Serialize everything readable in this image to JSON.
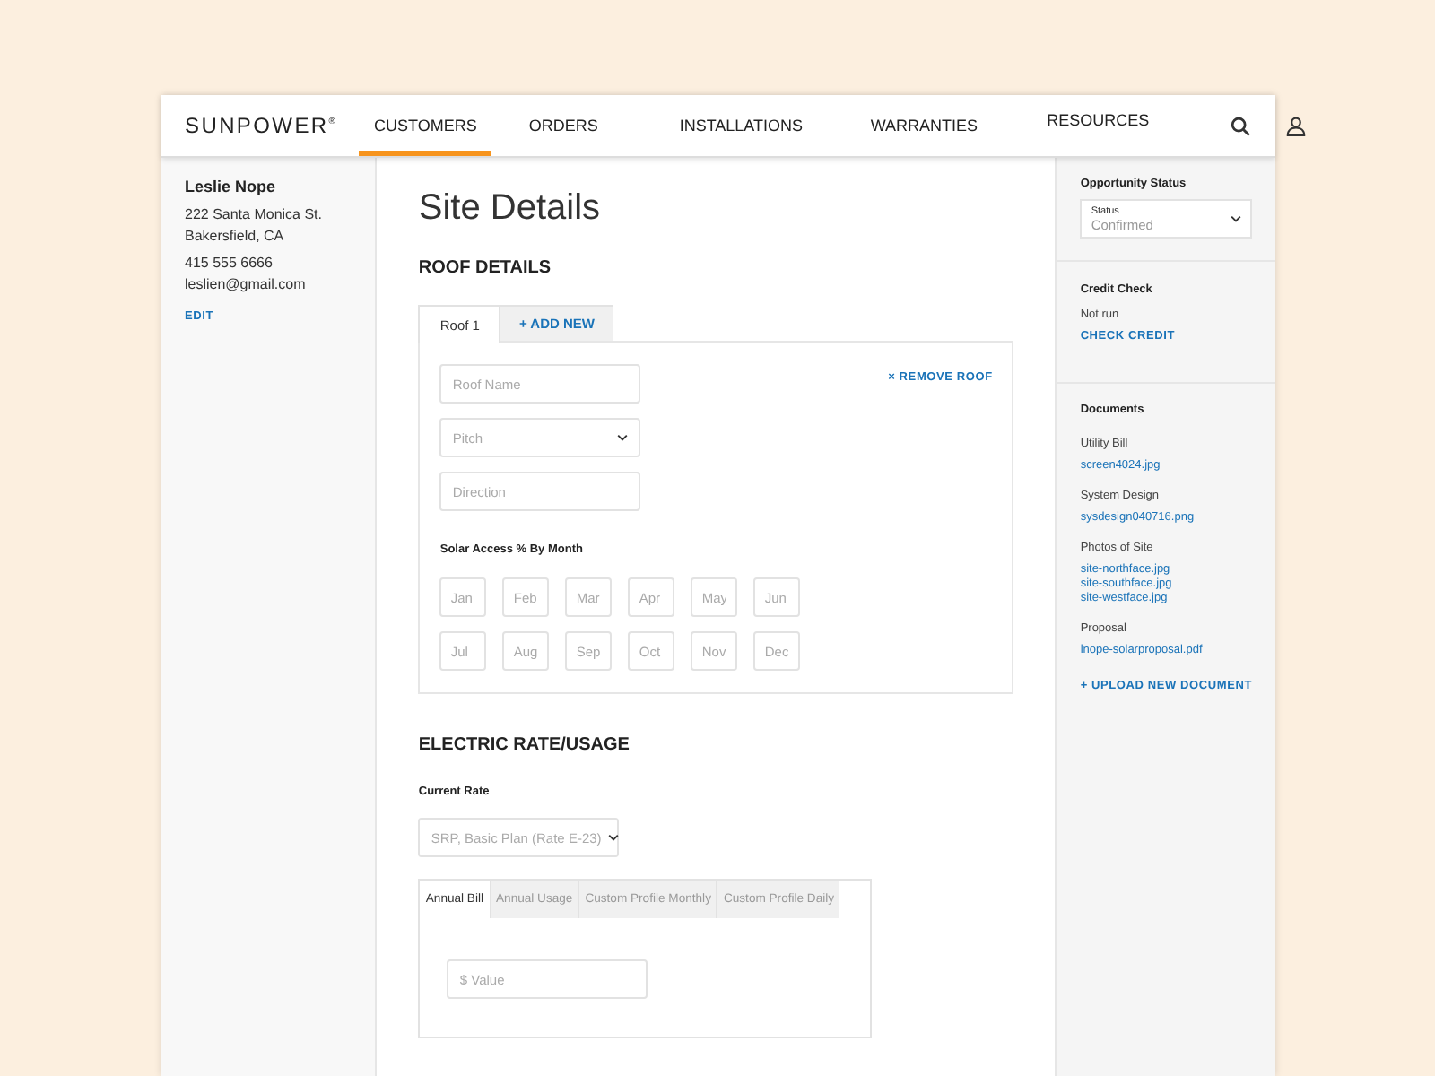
{
  "header": {
    "logo": "SUNPOWER$^{®}$",
    "nav": [
      {
        "label": "CUSTOMERS",
        "selected": true
      },
      {
        "label": "ORDERS",
        "selected": false
      },
      {
        "label": "INSTALLATIONS",
        "selected": false
      },
      {
        "label": "WARRANTIES",
        "selected": false
      },
      {
        "label": "RESOURCES",
        "selected": false
      }
    ]
  },
  "customer": {
    "name": "Leslie Nope",
    "address": [
      "222 Santa Monica St.",
      "Bakersfield, CA"
    ],
    "phone": "415 555 6666",
    "email": "leslien@gmail.com",
    "edit": "EDIT"
  },
  "main": {
    "title": "Site Details",
    "roof": {
      "heading": "ROOF DETAILS",
      "tabs": [
        {
          "label": "Roof 1",
          "selected": true
        },
        {
          "label": "+ ADD NEW",
          "selected": false
        }
      ],
      "remove": "× REMOVE ROOF",
      "fields": [
        {
          "kind": "text",
          "placeholder": "Roof Name"
        },
        {
          "kind": "select",
          "placeholder": "Pitch"
        },
        {
          "kind": "text",
          "placeholder": "Direction"
        }
      ],
      "solar_label": "Solar Access % By Month",
      "months": [
        {
          "placeholder": "Jan"
        },
        {
          "placeholder": "Feb"
        },
        {
          "placeholder": "Mar"
        },
        {
          "placeholder": "Apr"
        },
        {
          "placeholder": "May"
        },
        {
          "placeholder": "Jun"
        },
        {
          "placeholder": "Jul"
        },
        {
          "placeholder": "Aug"
        },
        {
          "placeholder": "Sep"
        },
        {
          "placeholder": "Oct"
        },
        {
          "placeholder": "Nov"
        },
        {
          "placeholder": "Dec"
        }
      ]
    },
    "electric": {
      "heading": "ELECTRIC RATE/USAGE",
      "rate_label": "Current Rate",
      "rate_value": "SRP, Basic Plan (Rate E-23)",
      "tabs": [
        {
          "label": "Annual Bill",
          "selected": true
        },
        {
          "label": "Annual Usage",
          "selected": false
        },
        {
          "label": "Custom Profile Monthly",
          "selected": false
        },
        {
          "label": "Custom Profile Daily",
          "selected": false
        }
      ],
      "value_placeholder": "$ Value"
    }
  },
  "sidebar": {
    "opportunity": {
      "heading": "Opportunity Status",
      "label": "Status",
      "value": "Confirmed"
    },
    "credit": {
      "heading": "Credit Check",
      "status": "Not run",
      "action": "CHECK CREDIT"
    },
    "documents": {
      "heading": "Documents",
      "groups": [
        {
          "title": "Utility Bill",
          "files": [
            "screen4024.jpg"
          ]
        },
        {
          "title": "System Design",
          "files": [
            "sysdesign040716.png"
          ]
        },
        {
          "title": "Photos of Site",
          "files": [
            "site-northface.jpg",
            "site-southface.jpg",
            "site-westface.jpg"
          ]
        },
        {
          "title": "Proposal",
          "files": [
            "lnope-solarproposal.pdf"
          ]
        }
      ],
      "upload": "+ UPLOAD NEW DOCUMENT"
    }
  }
}
